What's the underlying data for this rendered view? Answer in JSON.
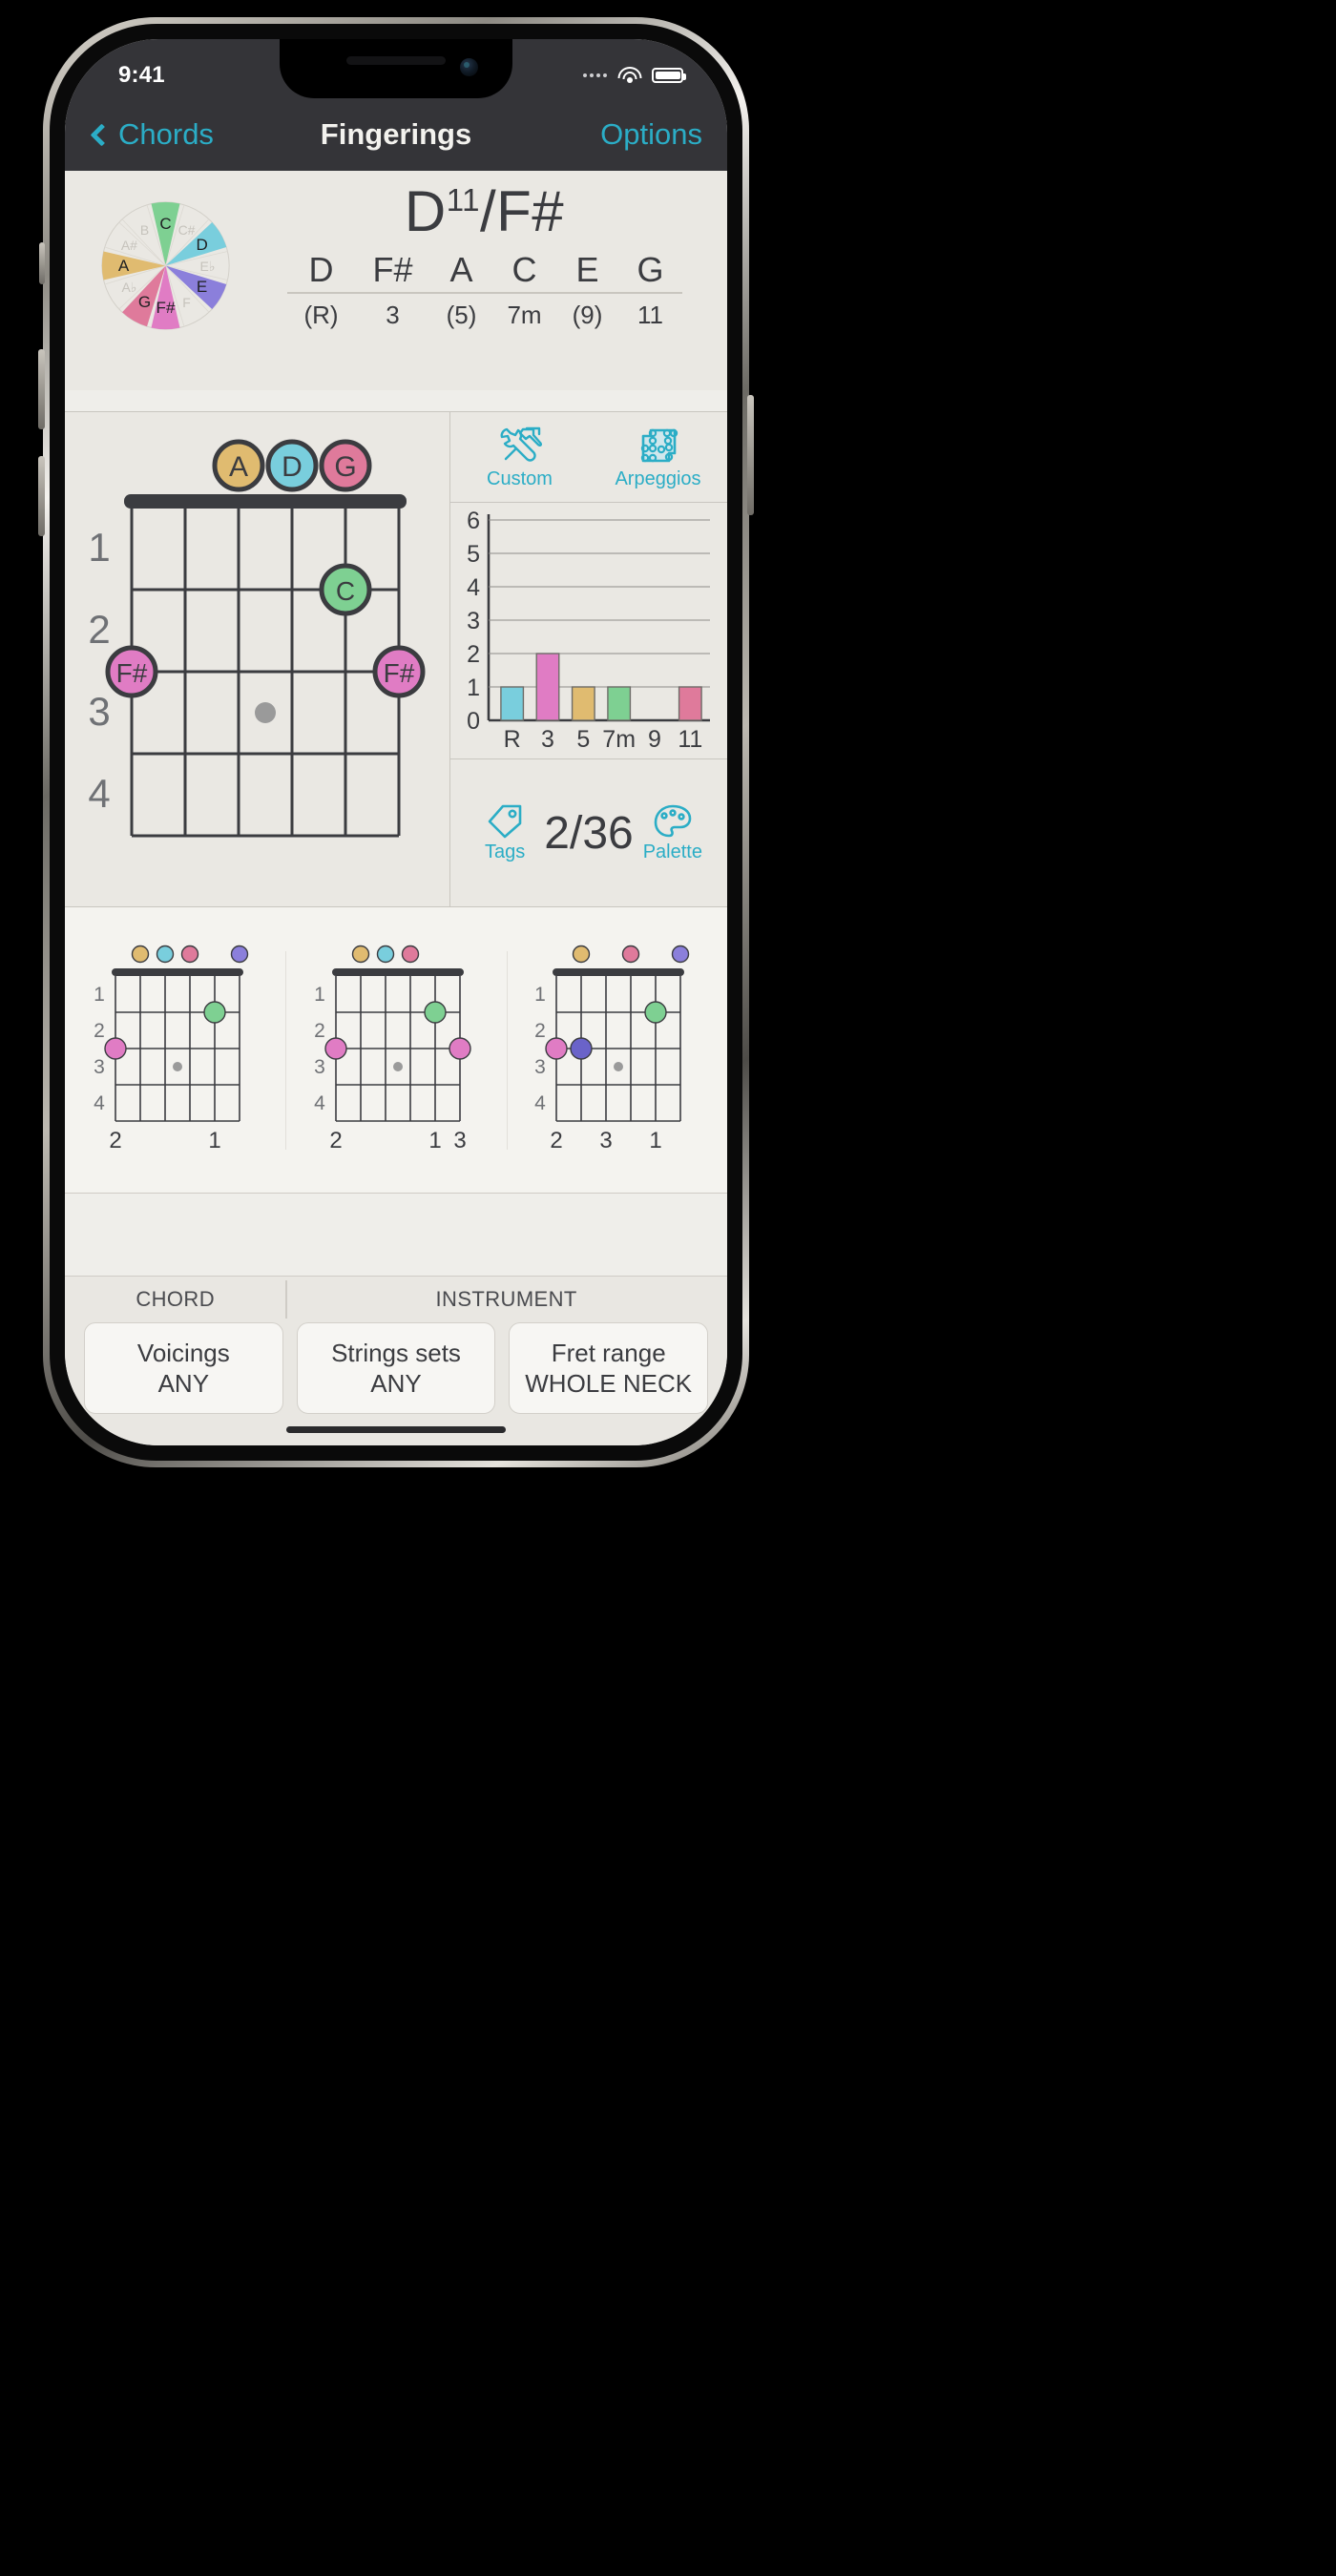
{
  "status_bar": {
    "time": "9:41",
    "wifi_icon": "wifi-icon",
    "battery_icon": "battery-icon",
    "signal_icon": "signal-dots-icon"
  },
  "nav": {
    "back_label": "Chords",
    "title": "Fingerings",
    "options_label": "Options",
    "back_icon": "chevron-left-icon",
    "accent": "#2badc6"
  },
  "chord": {
    "root": "D",
    "extension": "11",
    "slash": "/",
    "bass": "F#",
    "notes": [
      "D",
      "F#",
      "A",
      "C",
      "E",
      "G"
    ],
    "degrees": [
      "(R)",
      "3",
      "(5)",
      "7m",
      "(9)",
      "11"
    ]
  },
  "wheel": {
    "active": [
      {
        "label": "C",
        "color": "#7ed092"
      },
      {
        "label": "D",
        "color": "#79cedd"
      },
      {
        "label": "E",
        "color": "#8b7fdb"
      },
      {
        "label": "F#",
        "color": "#e07cc4"
      },
      {
        "label": "G",
        "color": "#df7a9b"
      },
      {
        "label": "A",
        "color": "#e0bb70"
      }
    ],
    "inactive": [
      "C#",
      "E♭",
      "F",
      "A♭",
      "A#",
      "B"
    ]
  },
  "fretboard": {
    "open_markers": [
      {
        "label": "A",
        "color": "#e0bb70"
      },
      {
        "label": "D",
        "color": "#79cedd"
      },
      {
        "label": "G",
        "color": "#df7a9b"
      }
    ],
    "fret_numbers": [
      "1",
      "2",
      "3",
      "4"
    ],
    "dots": [
      {
        "label": "C",
        "color": "#7ed092",
        "string": 5,
        "fret": 1
      },
      {
        "label": "F#",
        "color": "#e07cc4",
        "string": 1,
        "fret": 2
      },
      {
        "label": "F#",
        "color": "#e07cc4",
        "string": 6,
        "fret": 2
      }
    ],
    "inlay_label": "fret-inlay-dot"
  },
  "tools": {
    "custom_label": "Custom",
    "custom_icon": "hammer-wrench-icon",
    "arpeggios_label": "Arpeggios",
    "arpeggios_icon": "arpeggio-grid-icon",
    "tags_label": "Tags",
    "tags_icon": "tag-icon",
    "palette_label": "Palette",
    "palette_icon": "palette-icon",
    "counter": "2/36"
  },
  "chart_data": {
    "type": "bar",
    "title": "",
    "categories": [
      "R",
      "3",
      "5",
      "7m",
      "9",
      "11"
    ],
    "values": [
      1,
      2,
      1,
      1,
      0,
      1
    ],
    "colors": [
      "#79cedd",
      "#e07cc4",
      "#e0bb70",
      "#7ed092",
      "#eae8e3",
      "#df7a9b"
    ],
    "ylim": [
      0,
      6
    ],
    "yticks": [
      "0",
      "1",
      "2",
      "3",
      "4",
      "5",
      "6"
    ],
    "xlabel": "",
    "ylabel": "",
    "grid": true,
    "legend": "none"
  },
  "variants": [
    {
      "open_markers": [
        {
          "color": "#e0bb70",
          "string": 1
        },
        {
          "color": "#79cedd",
          "string": 2
        },
        {
          "color": "#df7a9b",
          "string": 3
        },
        {
          "color": "#8b7fdb",
          "string": 5
        }
      ],
      "fret_numbers": [
        "1",
        "2",
        "3",
        "4"
      ],
      "dots": [
        {
          "color": "#7ed092",
          "string": 4,
          "fret": 1
        },
        {
          "color": "#e07cc4",
          "string": 0,
          "fret": 2
        }
      ],
      "finger_row": [
        "2",
        "",
        "",
        "",
        "1",
        ""
      ]
    },
    {
      "open_markers": [
        {
          "color": "#e0bb70",
          "string": 1
        },
        {
          "color": "#79cedd",
          "string": 2
        },
        {
          "color": "#df7a9b",
          "string": 3
        }
      ],
      "fret_numbers": [
        "1",
        "2",
        "3",
        "4"
      ],
      "dots": [
        {
          "color": "#7ed092",
          "string": 4,
          "fret": 1
        },
        {
          "color": "#e07cc4",
          "string": 0,
          "fret": 2
        },
        {
          "color": "#e07cc4",
          "string": 5,
          "fret": 2
        }
      ],
      "finger_row": [
        "2",
        "",
        "",
        "",
        "1",
        "3"
      ]
    },
    {
      "open_markers": [
        {
          "color": "#e0bb70",
          "string": 1
        },
        {
          "color": "#df7a9b",
          "string": 3
        },
        {
          "color": "#8b7fdb",
          "string": 5
        }
      ],
      "fret_numbers": [
        "1",
        "2",
        "3",
        "4"
      ],
      "dots": [
        {
          "color": "#7ed092",
          "string": 4,
          "fret": 1
        },
        {
          "color": "#e07cc4",
          "string": 0,
          "fret": 2
        },
        {
          "color": "#6a63c9",
          "string": 1,
          "fret": 2
        }
      ],
      "finger_row": [
        "2",
        "",
        "3",
        "",
        "1",
        ""
      ]
    }
  ],
  "filters": {
    "heading_chord": "CHORD",
    "heading_instrument": "INSTRUMENT",
    "buttons": [
      {
        "title": "Voicings",
        "value": "ANY"
      },
      {
        "title": "Strings sets",
        "value": "ANY"
      },
      {
        "title": "Fret range",
        "value": "WHOLE NECK"
      }
    ]
  }
}
